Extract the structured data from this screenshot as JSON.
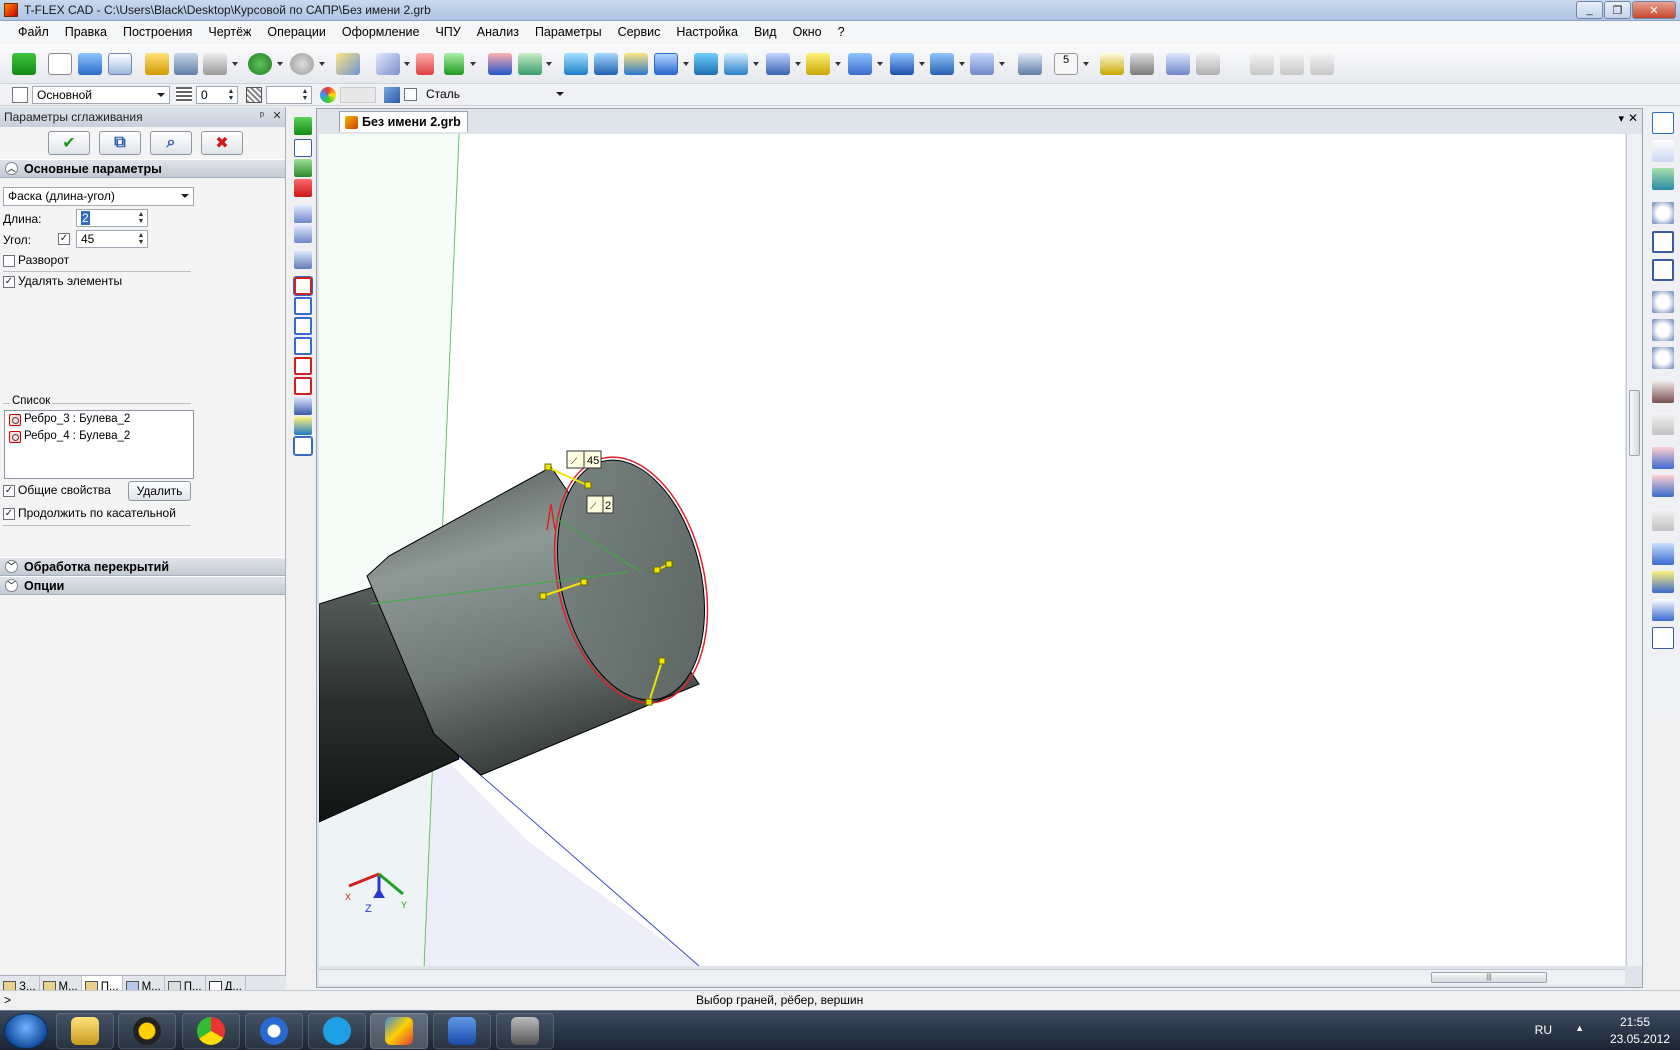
{
  "window": {
    "title": "T-FLEX CAD - C:\\Users\\Black\\Desktop\\Курсовой по САПР\\Без имени 2.grb",
    "minimize": "_",
    "maximize": "❐",
    "close": "✕"
  },
  "menu": [
    "Файл",
    "Правка",
    "Построения",
    "Чертёж",
    "Операции",
    "Оформление",
    "ЧПУ",
    "Анализ",
    "Параметры",
    "Сервис",
    "Настройка",
    "Вид",
    "Окно",
    "?"
  ],
  "toolbar2": {
    "layer_value": "Основной",
    "level_value": "0",
    "material_value": "Сталь",
    "dimension_badge": "5"
  },
  "panel": {
    "title": "Параметры сглаживания",
    "pin": "ᵖ",
    "close": "✕",
    "actions": {
      "ok": "✔",
      "preview": "⧉",
      "zoom": "⌕",
      "cancel": "✖"
    },
    "section_main": "Основные параметры",
    "chamfer_type": "Фаска (длина-угол)",
    "length_label": "Длина:",
    "length_value": "2",
    "angle_label": "Угол:",
    "angle_value": "45",
    "angle_checked": "✓",
    "flip_label": "Разворот",
    "delete_elements_label": "Удалять элементы",
    "delete_elements_checked": "✓",
    "list_label": "Список",
    "list_items": [
      "Ребро_3 : Булева_2",
      "Ребро_4 : Булева_2"
    ],
    "common_props_label": "Общие свойства",
    "common_props_checked": "✓",
    "delete_button": "Удалить",
    "tangent_label": "Продолжить по касательной",
    "tangent_checked": "✓",
    "section_overlap": "Обработка перекрытий",
    "section_options": "Опции",
    "bottom_tabs": [
      "З...",
      "М...",
      "П...",
      "М...",
      "П...",
      "Д..."
    ]
  },
  "document": {
    "tab_label": "Без имени 2.grb",
    "angle_tag": "45",
    "length_tag": "2",
    "axis_z": "Z",
    "axis_x": "X",
    "axis_y": "Y",
    "menu_arrow": "▾",
    "close": "✕",
    "scroll_grip": "|||"
  },
  "status": {
    "prompt": ">",
    "message": "Выбор граней, рёбер, вершин"
  },
  "taskbar": {
    "lang": "RU",
    "tray_arrow": "▲",
    "time": "21:55",
    "date": "23.05.2012"
  },
  "colors": {
    "accent": "#316ac5",
    "viewport_bg": "#ffffff",
    "model_gray": "#7d8a87",
    "edge_red": "#e0202a",
    "handle_yellow": "#f2e600"
  }
}
